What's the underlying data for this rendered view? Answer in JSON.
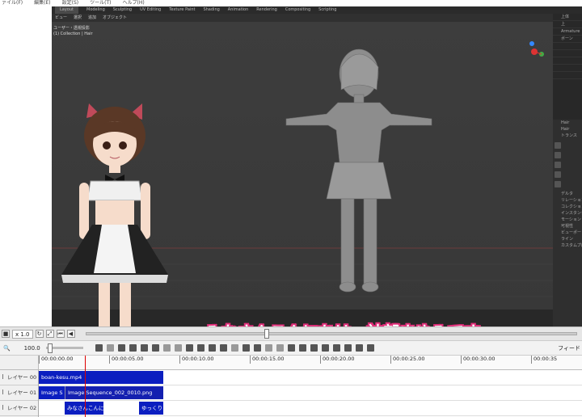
{
  "menubar": {
    "items": [
      "ァイル(F)",
      "編集(E)",
      "設定(S)",
      "ツール(T)",
      "ヘルプ(H)"
    ]
  },
  "blender": {
    "header_tabs": [
      "Layout",
      "Modeling",
      "Sculpting",
      "UV Editing",
      "Texture Paint",
      "Shading",
      "Animation",
      "Rendering",
      "Compositing",
      "Scripting"
    ],
    "toolbar_items": [
      "ビュー",
      "選択",
      "追加",
      "オブジェクト"
    ],
    "info_line1": "ユーザー・透視投影",
    "info_line2": "(1) Collection | Hair",
    "outliner_rows": [
      "上体",
      "上",
      "Armature",
      "ボーン",
      "",
      "",
      "",
      "",
      ""
    ],
    "props_labels": [
      "Hair",
      "Hair",
      "トランス",
      "",
      "",
      "",
      "",
      "",
      "",
      "",
      "デルタ",
      "リレーション",
      "コレクション",
      "インスタンシング",
      "モーション",
      "可視性",
      "ビューポート表示",
      "ライン",
      "カスタムプロパティ"
    ],
    "ruler_labels": [
      "",
      "",
      "",
      "",
      "",
      ""
    ]
  },
  "subtitle": "みなさんこんにちは、神部まゆみです。",
  "transport": {
    "speed": "x 1.0"
  },
  "tools": {
    "zoom": "100.0",
    "filter_label": "フィード"
  },
  "ruler": {
    "ticks": [
      "00:00:00.00",
      "00:00:05.00",
      "00:00:10.00",
      "00:00:15.00",
      "00:00:20.00",
      "00:00:25.00",
      "00:00:30.00",
      "00:00:35"
    ]
  },
  "layers": [
    "レイヤー 00",
    "レイヤー 01",
    "レイヤー 02"
  ],
  "clips": {
    "layer0": "boan-kesu.mp4",
    "layer1_a": "Image S",
    "layer1_b": "Image Sequence_002_0010.png",
    "layer2_a": "みなさんこんにち",
    "layer2_b": "ゆっくり"
  },
  "colors": {
    "clip_blue": "#0b1ec0",
    "subtitle_outline": "#e0307a",
    "playhead": "#dd0000"
  }
}
